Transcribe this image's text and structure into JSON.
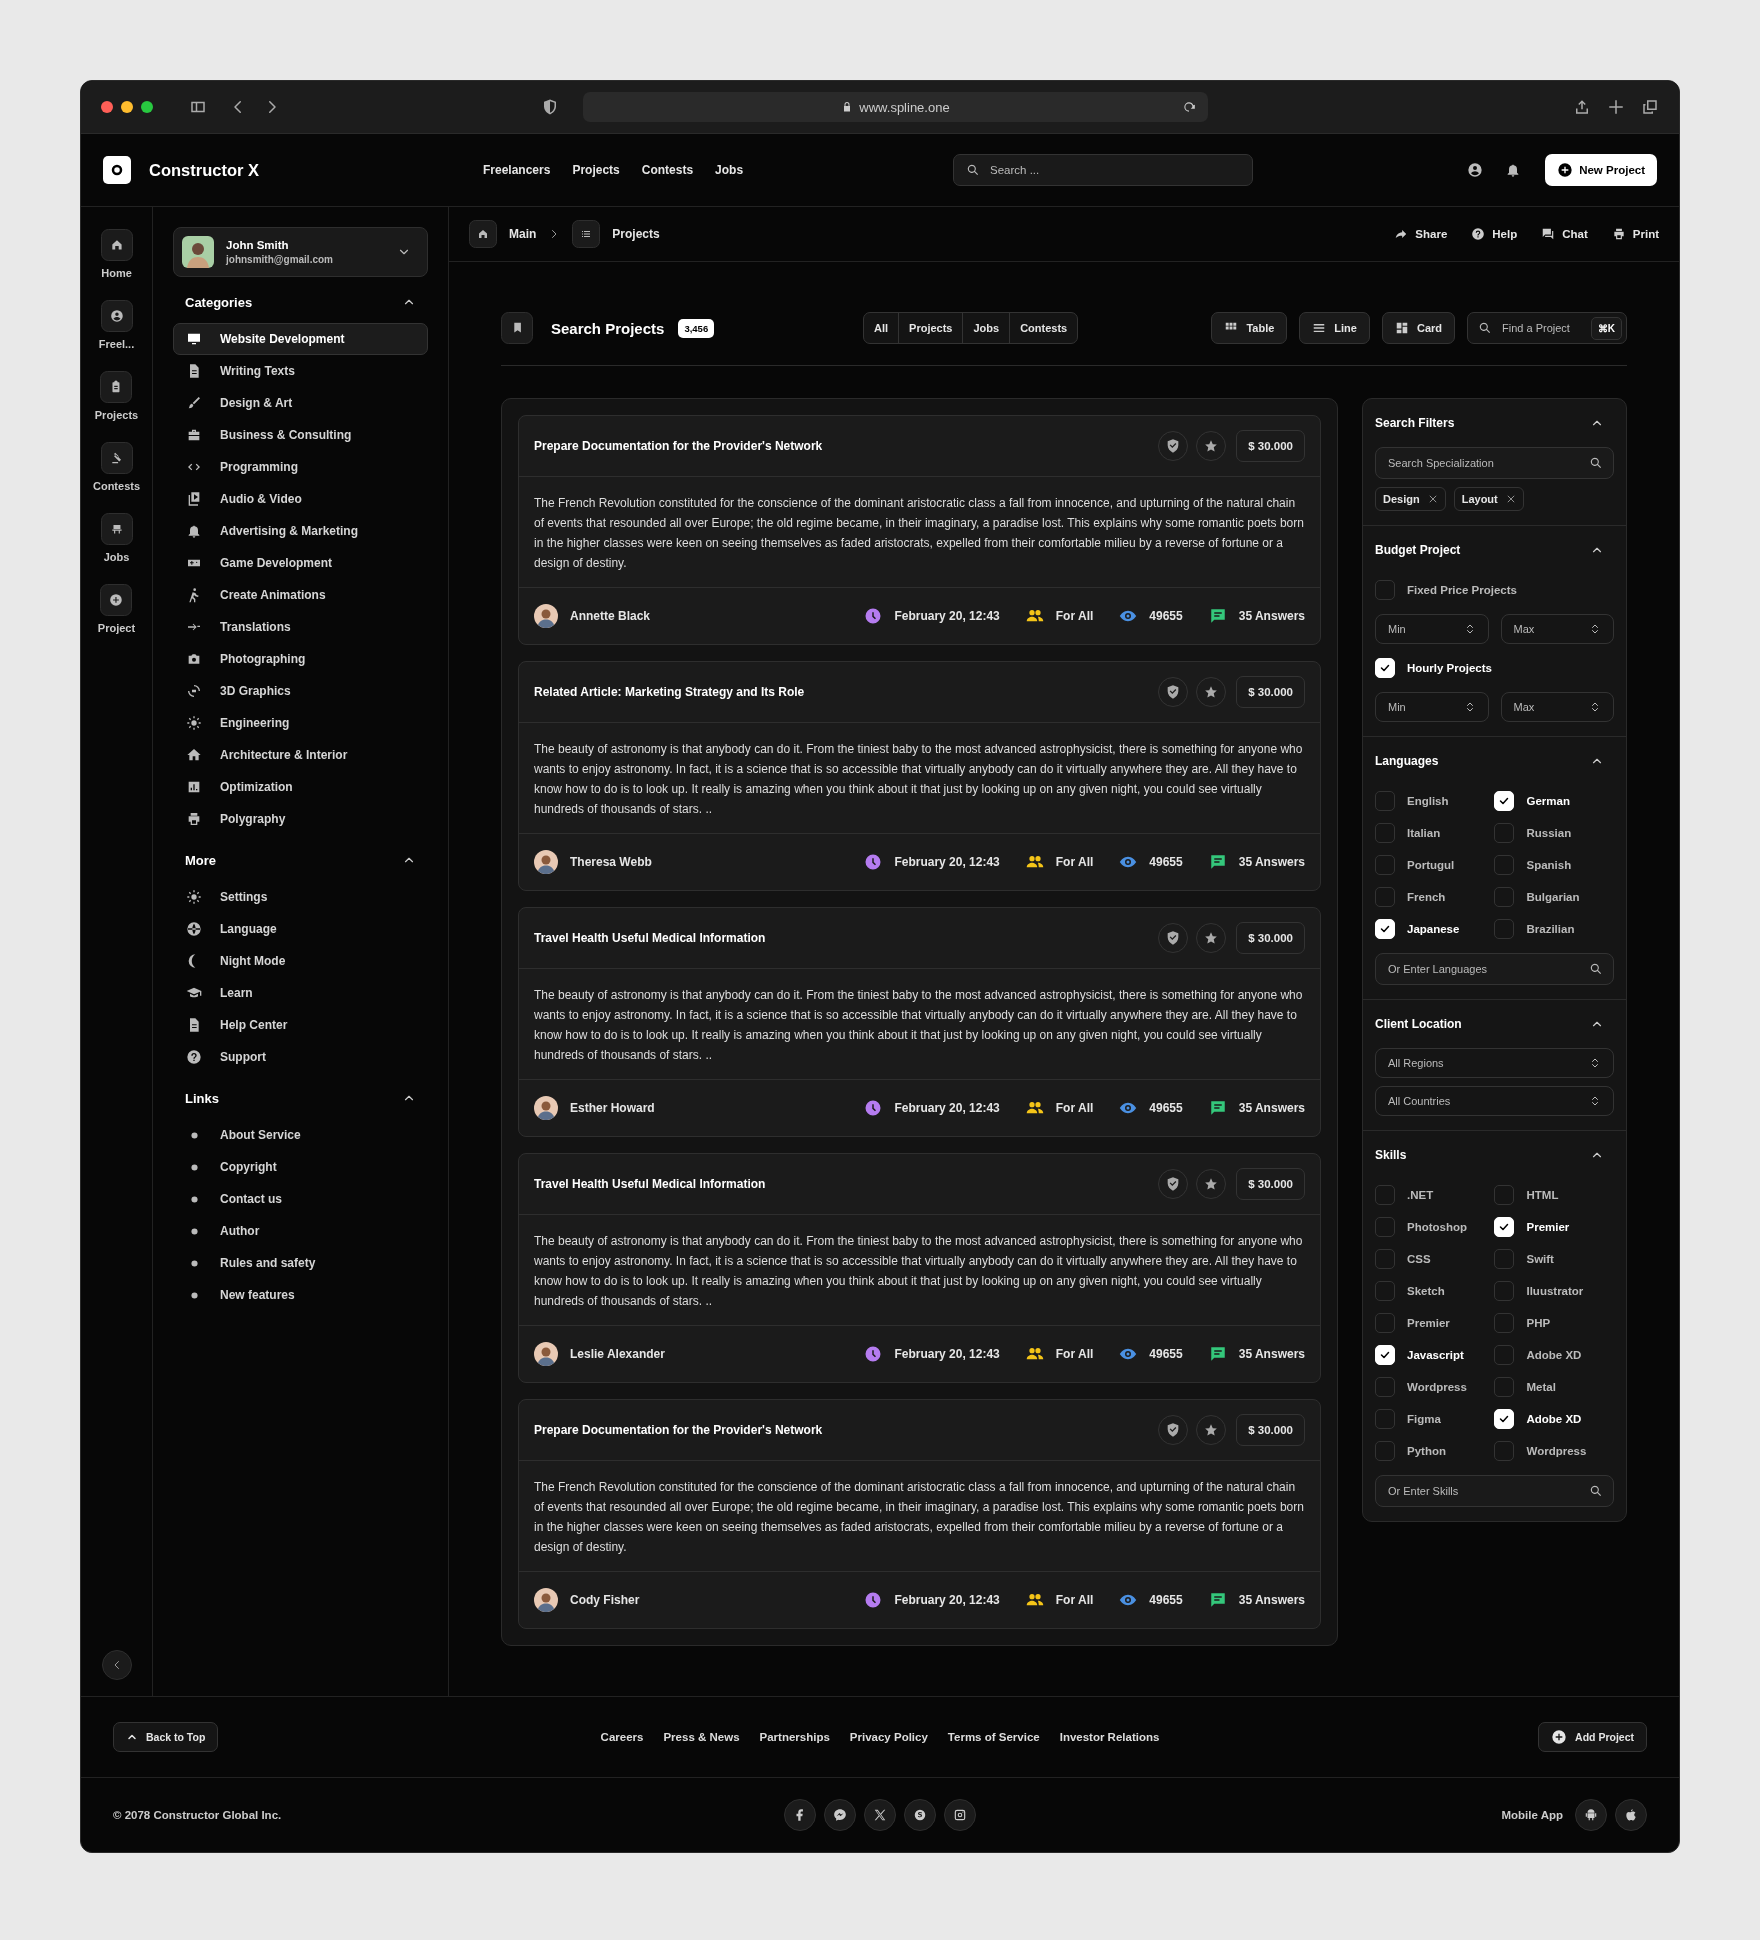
{
  "browser": {
    "url": "www.spline.one"
  },
  "header": {
    "brand": "Constructor X",
    "nav": [
      "Freelancers",
      "Projects",
      "Contests",
      "Jobs"
    ],
    "search_placeholder": "Search ...",
    "new_project": "New Project"
  },
  "rail": [
    "Home",
    "Freel...",
    "Projects",
    "Contests",
    "Jobs",
    "Project"
  ],
  "user": {
    "name": "John Smith",
    "email": "johnsmith@gmail.com"
  },
  "sidebar": [
    {
      "title": "Categories",
      "expanded": true,
      "kind": "icons",
      "items": [
        {
          "label": "Website Development",
          "selected": true
        },
        {
          "label": "Writing Texts",
          "selected": false
        },
        {
          "label": "Design & Art",
          "selected": false
        },
        {
          "label": "Business & Consulting",
          "selected": false
        },
        {
          "label": "Programming",
          "selected": false
        },
        {
          "label": "Audio & Video",
          "selected": false
        },
        {
          "label": "Advertising & Marketing",
          "selected": false
        },
        {
          "label": "Game Development",
          "selected": false
        },
        {
          "label": "Create Animations",
          "selected": false
        },
        {
          "label": "Translations",
          "selected": false
        },
        {
          "label": "Photographing",
          "selected": false
        },
        {
          "label": "3D Graphics",
          "selected": false
        },
        {
          "label": "Engineering",
          "selected": false
        },
        {
          "label": "Architecture & Interior",
          "selected": false
        },
        {
          "label": "Optimization",
          "selected": false
        },
        {
          "label": "Polygraphy",
          "selected": false
        }
      ]
    },
    {
      "title": "More",
      "expanded": true,
      "kind": "icons",
      "items": [
        {
          "label": "Settings",
          "selected": false
        },
        {
          "label": "Language",
          "selected": false
        },
        {
          "label": "Night Mode",
          "selected": false
        },
        {
          "label": "Learn",
          "selected": false
        },
        {
          "label": "Help Center",
          "selected": false
        },
        {
          "label": "Support",
          "selected": false
        }
      ]
    },
    {
      "title": "Links",
      "expanded": true,
      "kind": "bullets",
      "items": [
        {
          "label": "About Service",
          "selected": false
        },
        {
          "label": "Copyright",
          "selected": false
        },
        {
          "label": "Contact us",
          "selected": false
        },
        {
          "label": "Author",
          "selected": false
        },
        {
          "label": "Rules and safety",
          "selected": false
        },
        {
          "label": "New features",
          "selected": false
        }
      ]
    }
  ],
  "breadcrumb": [
    "Main",
    "Projects"
  ],
  "actions": [
    "Share",
    "Help",
    "Chat",
    "Print"
  ],
  "search": {
    "title": "Search Projects",
    "count": "3,456",
    "tabs": [
      "All",
      "Projects",
      "Jobs",
      "Contests"
    ],
    "views": [
      "Table",
      "Line",
      "Card"
    ],
    "find_placeholder": "Find a Project",
    "shortcut": "⌘K"
  },
  "projects": [
    {
      "title": "Prepare Documentation for the Provider's Network",
      "price": "$ 30.000",
      "description": "The French Revolution constituted for the conscience of the dominant aristocratic class a fall from innocence, and upturning of the natural chain of events that resounded all over Europe; the old regime became, in their imaginary, a paradise lost. This explains why some romantic poets born in the higher classes were keen on seeing themselves as faded aristocrats, expelled from their comfortable milieu by a reverse of fortune or a design of destiny.",
      "author": "Annette Black",
      "date": "February 20, 12:43",
      "audience": "For All",
      "views": "49655",
      "answers": "35 Answers"
    },
    {
      "title": "Related Article: Marketing Strategy and Its Role",
      "price": "$ 30.000",
      "description": "The beauty of astronomy is that anybody can do it. From the tiniest baby to the most advanced astrophysicist, there is something for anyone who wants to enjoy astronomy. In fact, it is a science that is so accessible that virtually anybody can do it virtually anywhere they are. All they have to know how to do is to look up. It really is amazing when you think about it that just by looking up on any given night, you could see virtually hundreds of thousands of stars. ..",
      "author": "Theresa Webb",
      "date": "February 20, 12:43",
      "audience": "For All",
      "views": "49655",
      "answers": "35 Answers"
    },
    {
      "title": "Travel Health Useful Medical Information",
      "price": "$ 30.000",
      "description": "The beauty of astronomy is that anybody can do it. From the tiniest baby to the most advanced astrophysicist, there is something for anyone who wants to enjoy astronomy. In fact, it is a science that is so accessible that virtually anybody can do it virtually anywhere they are. All they have to know how to do is to look up. It really is amazing when you think about it that just by looking up on any given night, you could see virtually hundreds of thousands of stars. ..",
      "author": "Esther Howard",
      "date": "February 20, 12:43",
      "audience": "For All",
      "views": "49655",
      "answers": "35 Answers"
    },
    {
      "title": "Travel Health Useful Medical Information",
      "price": "$ 30.000",
      "description": "The beauty of astronomy is that anybody can do it. From the tiniest baby to the most advanced astrophysicist, there is something for anyone who wants to enjoy astronomy. In fact, it is a science that is so accessible that virtually anybody can do it virtually anywhere they are. All they have to know how to do is to look up. It really is amazing when you think about it that just by looking up on any given night, you could see virtually hundreds of thousands of stars. ..",
      "author": "Leslie Alexander",
      "date": "February 20, 12:43",
      "audience": "For All",
      "views": "49655",
      "answers": "35 Answers"
    },
    {
      "title": "Prepare Documentation for the Provider's Network",
      "price": "$ 30.000",
      "description": "The French Revolution constituted for the conscience of the dominant aristocratic class a fall from innocence, and upturning of the natural chain of events that resounded all over Europe; the old regime became, in their imaginary, a paradise lost. This explains why some romantic poets born in the higher classes were keen on seeing themselves as faded aristocrats, expelled from their comfortable milieu by a reverse of fortune or a design of destiny.",
      "author": "Cody Fisher",
      "date": "February 20, 12:43",
      "audience": "For All",
      "views": "49655",
      "answers": "35 Answers"
    }
  ],
  "filters": [
    {
      "kind": "search",
      "title": "Search Filters",
      "expanded": true,
      "placeholder": "Search Specialization",
      "tags": [
        "Design",
        "Layout"
      ]
    },
    {
      "kind": "budget",
      "title": "Budget Project",
      "expanded": true,
      "options": [
        {
          "label": "Fixed Price Projects",
          "checked": false,
          "min": "Min",
          "max": "Max"
        },
        {
          "label": "Hourly Projects",
          "checked": true,
          "min": "Min",
          "max": "Max"
        }
      ]
    },
    {
      "kind": "checklist",
      "title": "Languages",
      "expanded": true,
      "placeholder": "Or Enter Languages",
      "options": [
        {
          "label": "English",
          "checked": false
        },
        {
          "label": "German",
          "checked": true
        },
        {
          "label": "Italian",
          "checked": false
        },
        {
          "label": "Russian",
          "checked": false
        },
        {
          "label": "Portugul",
          "checked": false
        },
        {
          "label": "Spanish",
          "checked": false
        },
        {
          "label": "French",
          "checked": false
        },
        {
          "label": "Bulgarian",
          "checked": false
        },
        {
          "label": "Japanese",
          "checked": true
        },
        {
          "label": "Brazilian",
          "checked": false
        }
      ]
    },
    {
      "kind": "selects",
      "title": "Client Location",
      "expanded": true,
      "selects": [
        "All Regions",
        "All Countries"
      ]
    },
    {
      "kind": "checklist",
      "title": "Skills",
      "expanded": true,
      "placeholder": "Or Enter Skills",
      "options": [
        {
          "label": ".NET",
          "checked": false
        },
        {
          "label": "HTML",
          "checked": false
        },
        {
          "label": "Photoshop",
          "checked": false
        },
        {
          "label": "Premier",
          "checked": true
        },
        {
          "label": "CSS",
          "checked": false
        },
        {
          "label": "Swift",
          "checked": false
        },
        {
          "label": "Sketch",
          "checked": false
        },
        {
          "label": "Iluustrator",
          "checked": false
        },
        {
          "label": "Premier",
          "checked": false
        },
        {
          "label": "PHP",
          "checked": false
        },
        {
          "label": "Javascript",
          "checked": true
        },
        {
          "label": "Adobe XD",
          "checked": false
        },
        {
          "label": "Wordpress",
          "checked": false
        },
        {
          "label": "Metal",
          "checked": false
        },
        {
          "label": "Figma",
          "checked": false
        },
        {
          "label": "Adobe XD",
          "checked": true
        },
        {
          "label": "Python",
          "checked": false
        },
        {
          "label": "Wordpress",
          "checked": false
        }
      ]
    }
  ],
  "footer": {
    "back_to_top": "Back to Top",
    "links": [
      "Careers",
      "Press & News",
      "Partnerships",
      "Privacy Policy",
      "Terms of Service",
      "Investor Relations"
    ],
    "add_project": "Add Project",
    "copyright": "© 2078 Constructor Global Inc.",
    "mobile_app": "Mobile App"
  }
}
